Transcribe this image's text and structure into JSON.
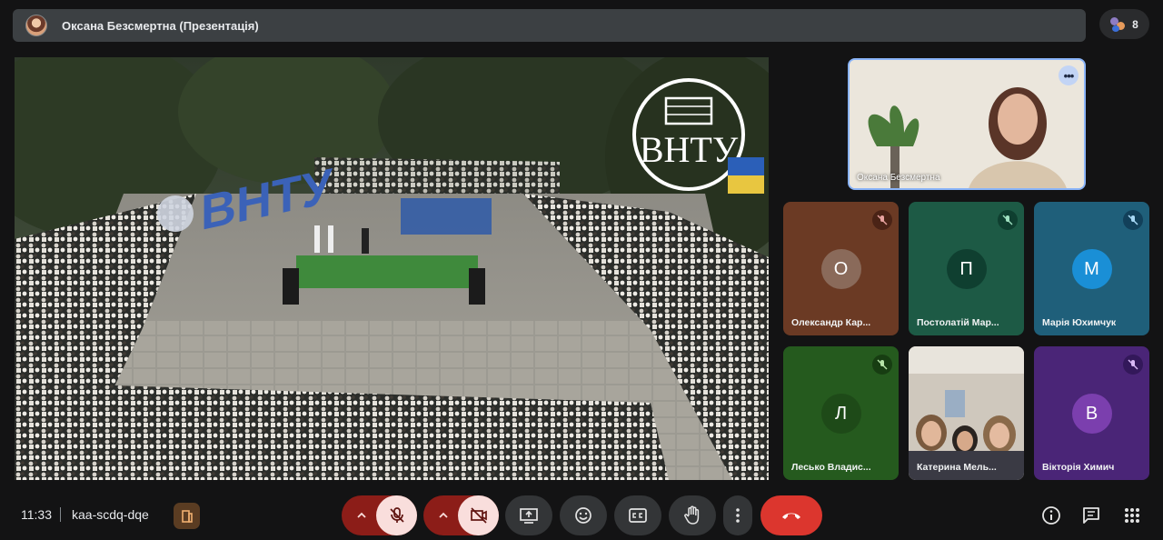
{
  "header": {
    "presenter_label": "Оксана Безсмертна (Презентація)",
    "participant_count": "8"
  },
  "presentation": {
    "logo_text": "ВНТУ",
    "sign_text": "ВНТУ"
  },
  "featured_tile": {
    "name": "Оксана Безсмертна"
  },
  "participants": [
    {
      "name": "Олександр Кар...",
      "initial": "О",
      "bg": "#6b3a24",
      "avatar_bg": "#8a6a5a",
      "muted": true
    },
    {
      "name": "Постолатій Мар...",
      "initial": "П",
      "bg": "#1d5a45",
      "avatar_bg": "#0f3f30",
      "muted": true
    },
    {
      "name": "Марія Юхимчук",
      "initial": "М",
      "bg": "#1f5f7a",
      "avatar_bg": "#1a8fd6",
      "muted": true
    },
    {
      "name": "Лесько Владис...",
      "initial": "Л",
      "bg": "#255a1e",
      "avatar_bg": "#1e4a18",
      "muted": true
    },
    {
      "name": "Катерина Мель...",
      "initial": "",
      "bg": "#b8b3aa",
      "avatar_bg": "",
      "muted": false
    },
    {
      "name": "Вікторія Химич",
      "initial": "В",
      "bg": "#4a2577",
      "avatar_bg": "#7b3fae",
      "muted": true
    }
  ],
  "footer": {
    "time": "11:33",
    "meeting_code": "kaa-scdq-dqe"
  },
  "colors": {
    "danger": "#8c1d18",
    "danger_light": "#f9dedc",
    "hangup": "#dc362e",
    "accent": "#8ab4f8",
    "control_bg": "#333537"
  }
}
